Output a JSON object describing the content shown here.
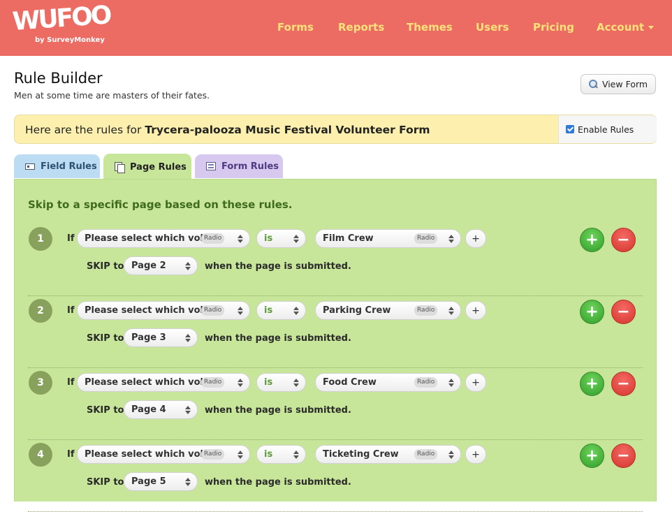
{
  "brand": {
    "logo": "WUFOO",
    "sub": "by SurveyMonkey"
  },
  "nav": [
    {
      "label": "Forms"
    },
    {
      "label": "Reports"
    },
    {
      "label": "Themes"
    },
    {
      "label": "Users"
    },
    {
      "label": "Pricing"
    },
    {
      "label": "Account"
    }
  ],
  "page": {
    "title": "Rule Builder",
    "subtitle": "Men at some time are masters of their fates.",
    "view_form": "View Form"
  },
  "banner": {
    "prefix": "Here are the rules for ",
    "form_name": "Trycera-palooza Music Festival Volunteer Form",
    "enable_label": "Enable Rules"
  },
  "tabs": [
    {
      "label": "Field Rules"
    },
    {
      "label": "Page Rules"
    },
    {
      "label": "Form Rules"
    }
  ],
  "panel": {
    "heading": "Skip to a specific page based on these rules."
  },
  "rule_labels": {
    "if": "If",
    "skip": "SKIP to",
    "when": "when the page is submitted.",
    "field_type": "Radio",
    "add_condition": "+",
    "add_rule": "+",
    "remove_rule": "−"
  },
  "rules": [
    {
      "num": "1",
      "field": "Please select which volu",
      "op": "is",
      "value": "Film Crew",
      "page": "Page 2"
    },
    {
      "num": "2",
      "field": "Please select which volu",
      "op": "is",
      "value": "Parking Crew",
      "page": "Page 3"
    },
    {
      "num": "3",
      "field": "Please select which volu",
      "op": "is",
      "value": "Food Crew",
      "page": "Page 4"
    },
    {
      "num": "4",
      "field": "Please select which volu",
      "op": "is",
      "value": "Ticketing Crew",
      "page": "Page 5"
    }
  ]
}
